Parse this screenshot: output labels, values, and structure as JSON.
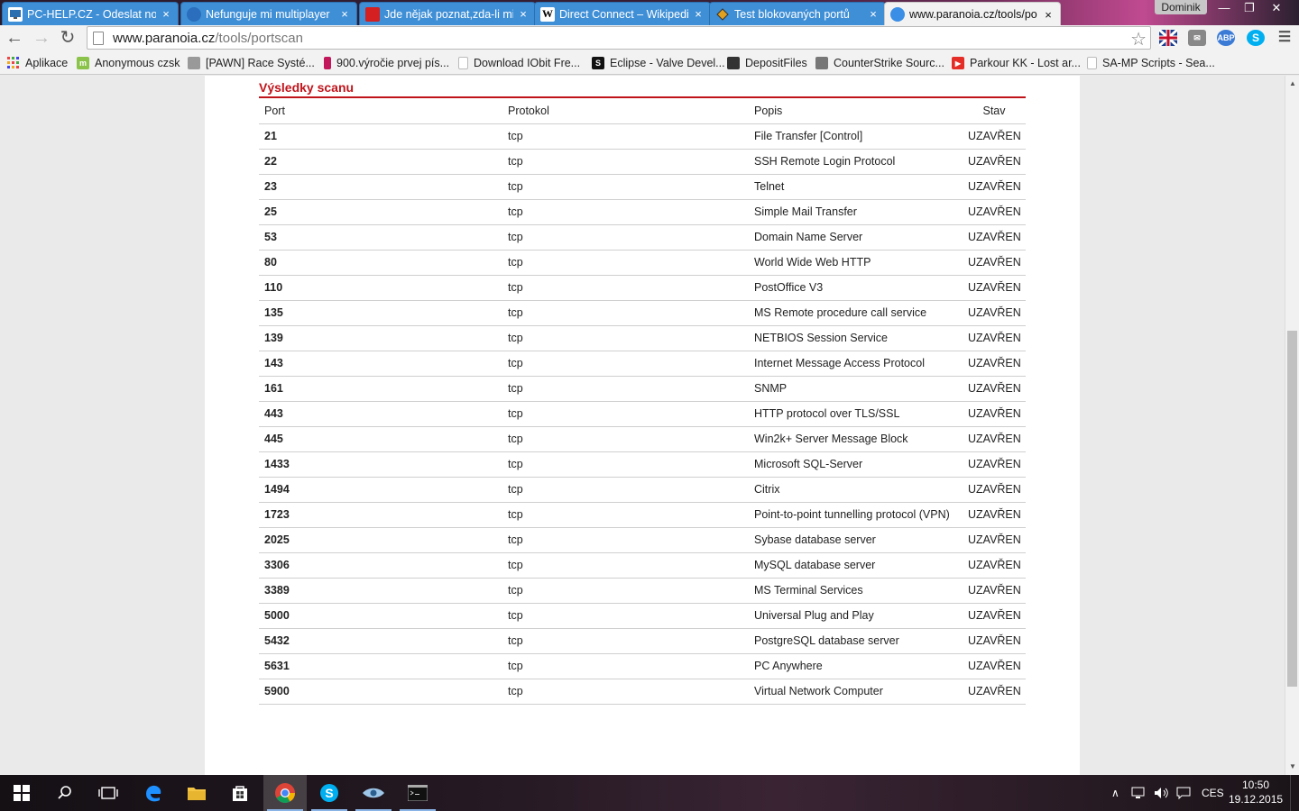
{
  "browser": {
    "tabs": [
      {
        "title": "PC-HELP.CZ - Odeslat nov",
        "icon": "pc-help-icon"
      },
      {
        "title": "Nefunguje mi multiplayer",
        "icon": "globe-icon"
      },
      {
        "title": "Jde nějak poznat,zda-li mi",
        "icon": "zive-icon"
      },
      {
        "title": "Direct Connect – Wikipedi",
        "icon": "wikipedia-icon"
      },
      {
        "title": "Test blokovaných portů",
        "icon": "diamond-icon"
      },
      {
        "title": "www.paranoia.cz/tools/po",
        "icon": "globe-icon"
      }
    ],
    "tab_close": "×",
    "user_name": "Dominik",
    "url_host": "www.paranoia.cz",
    "url_path": "/tools/portscan",
    "extensions": [
      "flag-uk-icon",
      "mail-icon",
      "adblock-icon",
      "skype-icon",
      "menu-icon"
    ],
    "ext_labels": {
      "adblock": "ABP",
      "skype": "S"
    },
    "bookmarks": [
      {
        "label": "Aplikace",
        "icon": "apps-grid-icon"
      },
      {
        "label": "Anonymous czsk",
        "icon": "m-icon"
      },
      {
        "label": "[PAWN] Race Systé...",
        "icon": "pawn-icon"
      },
      {
        "label": "900.výročie prvej pís...",
        "icon": "dot-icon"
      },
      {
        "label": "Download IObit Fre...",
        "icon": "page-icon"
      },
      {
        "label": "Eclipse - Valve Devel...",
        "icon": "valve-icon"
      },
      {
        "label": "DepositFiles",
        "icon": "depositfiles-icon"
      },
      {
        "label": "CounterStrike Sourc...",
        "icon": "cs-icon"
      },
      {
        "label": "Parkour KK - Lost ar...",
        "icon": "youtube-icon"
      },
      {
        "label": "SA-MP Scripts - Sea...",
        "icon": "page-icon"
      }
    ]
  },
  "page": {
    "section_title": "Výsledky scanu",
    "columns": {
      "port": "Port",
      "protocol": "Protokol",
      "description": "Popis",
      "status": "Stav"
    },
    "rows": [
      {
        "port": "21",
        "protocol": "tcp",
        "description": "File Transfer [Control]",
        "status": "UZAVŘEN"
      },
      {
        "port": "22",
        "protocol": "tcp",
        "description": "SSH Remote Login Protocol",
        "status": "UZAVŘEN"
      },
      {
        "port": "23",
        "protocol": "tcp",
        "description": "Telnet",
        "status": "UZAVŘEN"
      },
      {
        "port": "25",
        "protocol": "tcp",
        "description": "Simple Mail Transfer",
        "status": "UZAVŘEN"
      },
      {
        "port": "53",
        "protocol": "tcp",
        "description": "Domain Name Server",
        "status": "UZAVŘEN"
      },
      {
        "port": "80",
        "protocol": "tcp",
        "description": "World Wide Web HTTP",
        "status": "UZAVŘEN"
      },
      {
        "port": "110",
        "protocol": "tcp",
        "description": "PostOffice V3",
        "status": "UZAVŘEN"
      },
      {
        "port": "135",
        "protocol": "tcp",
        "description": "MS Remote procedure call service",
        "status": "UZAVŘEN"
      },
      {
        "port": "139",
        "protocol": "tcp",
        "description": "NETBIOS Session Service",
        "status": "UZAVŘEN"
      },
      {
        "port": "143",
        "protocol": "tcp",
        "description": "Internet Message Access Protocol",
        "status": "UZAVŘEN"
      },
      {
        "port": "161",
        "protocol": "tcp",
        "description": "SNMP",
        "status": "UZAVŘEN"
      },
      {
        "port": "443",
        "protocol": "tcp",
        "description": "HTTP protocol over TLS/SSL",
        "status": "UZAVŘEN"
      },
      {
        "port": "445",
        "protocol": "tcp",
        "description": "Win2k+ Server Message Block",
        "status": "UZAVŘEN"
      },
      {
        "port": "1433",
        "protocol": "tcp",
        "description": "Microsoft SQL-Server",
        "status": "UZAVŘEN"
      },
      {
        "port": "1494",
        "protocol": "tcp",
        "description": "Citrix",
        "status": "UZAVŘEN"
      },
      {
        "port": "1723",
        "protocol": "tcp",
        "description": "Point-to-point tunnelling protocol (VPN)",
        "status": "UZAVŘEN"
      },
      {
        "port": "2025",
        "protocol": "tcp",
        "description": "Sybase database server",
        "status": "UZAVŘEN"
      },
      {
        "port": "3306",
        "protocol": "tcp",
        "description": "MySQL database server",
        "status": "UZAVŘEN"
      },
      {
        "port": "3389",
        "protocol": "tcp",
        "description": "MS Terminal Services",
        "status": "UZAVŘEN"
      },
      {
        "port": "5000",
        "protocol": "tcp",
        "description": "Universal Plug and Play",
        "status": "UZAVŘEN"
      },
      {
        "port": "5432",
        "protocol": "tcp",
        "description": "PostgreSQL database server",
        "status": "UZAVŘEN"
      },
      {
        "port": "5631",
        "protocol": "tcp",
        "description": "PC Anywhere",
        "status": "UZAVŘEN"
      },
      {
        "port": "5900",
        "protocol": "tcp",
        "description": "Virtual Network Computer",
        "status": "UZAVŘEN"
      }
    ]
  },
  "taskbar": {
    "apps": [
      "windows-start-icon",
      "search-icon",
      "task-view-icon",
      "edge-icon",
      "file-explorer-icon",
      "store-icon",
      "chrome-icon",
      "skype-icon",
      "eye-app-icon",
      "terminal-icon"
    ],
    "language": "CES",
    "time": "10:50",
    "date": "19.12.2015"
  },
  "colors": {
    "accent_red": "#c0141b",
    "tab_blue": "#3f8fd6"
  }
}
